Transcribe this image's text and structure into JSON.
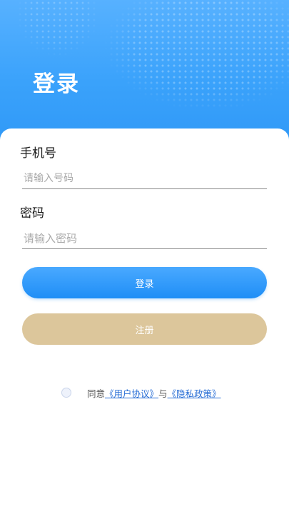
{
  "header": {
    "title": "登录"
  },
  "form": {
    "phone_label": "手机号",
    "phone_placeholder": "请输入号码",
    "password_label": "密码",
    "password_placeholder": "请输入密码"
  },
  "buttons": {
    "login_label": "登录",
    "register_label": "注册"
  },
  "agreement": {
    "prefix": "同意",
    "user_agreement": "《用户协议》",
    "connector": "与",
    "privacy_policy": "《隐私政策》"
  },
  "colors": {
    "primary_blue": "#2f98f7",
    "register_gold": "#dcc69b",
    "link_blue": "#2a6fd6"
  }
}
